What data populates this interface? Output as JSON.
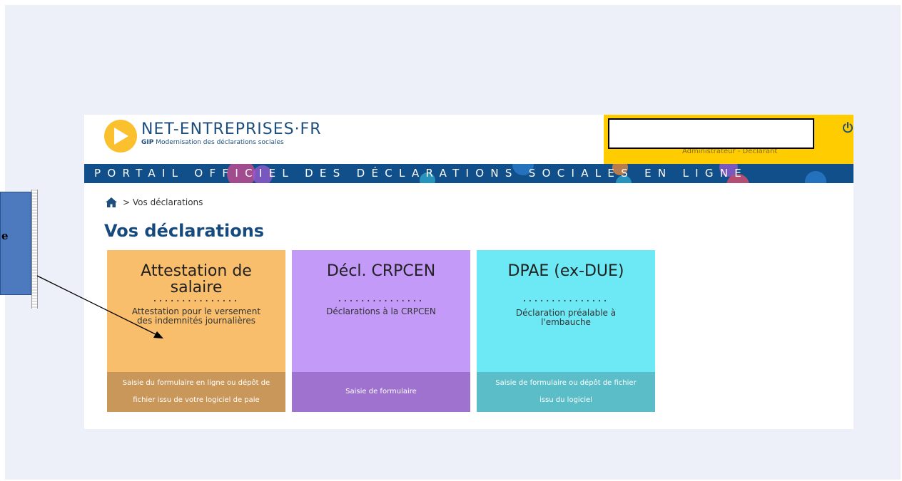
{
  "header": {
    "brand_name": "NET-ENTREPRISES·FR",
    "brand_sub_bold": "GIP",
    "brand_sub": " Modernisation des déclarations sociales",
    "user_role": "Administrateur - Déclarant",
    "banner": "PORTAIL OFFICIEL DES DÉCLARATIONS SOCIALES EN LIGNE"
  },
  "breadcrumb": {
    "separator": ">",
    "current": "Vos déclarations"
  },
  "page_title": "Vos déclarations",
  "cards": [
    {
      "title_line1": "Attestation de",
      "title_line2": "salaire",
      "dots": "...............",
      "description_line1": "Attestation pour le versement",
      "description_line2": "des indemnités journalières",
      "footer_line1": "Saisie du formulaire en ligne ou dépôt de",
      "footer_line2": "fichier issu de votre logiciel de paie"
    },
    {
      "title_line1": "Décl. CRPCEN",
      "dots": "...............",
      "description_line1": "Déclarations à la CRPCEN",
      "footer_line1": "Saisie de formulaire"
    },
    {
      "title_line1": "DPAE (ex-DUE)",
      "dots": "...............",
      "description_line1": "Déclaration préalable à",
      "description_line2": "l'embauche",
      "footer_line1": "Saisie de formulaire ou dépôt de fichier",
      "footer_line2": "issu du logiciel"
    }
  ],
  "callout": {
    "label": "e"
  },
  "icons": {
    "logo": "play-icon",
    "power": "power-icon",
    "home": "home-icon"
  },
  "colors": {
    "brand_blue": "#114f8a",
    "brand_yellow": "#ffcc00",
    "card_orange": "#f8be6b",
    "card_purple": "#c49af8",
    "card_cyan": "#6de9f5"
  }
}
